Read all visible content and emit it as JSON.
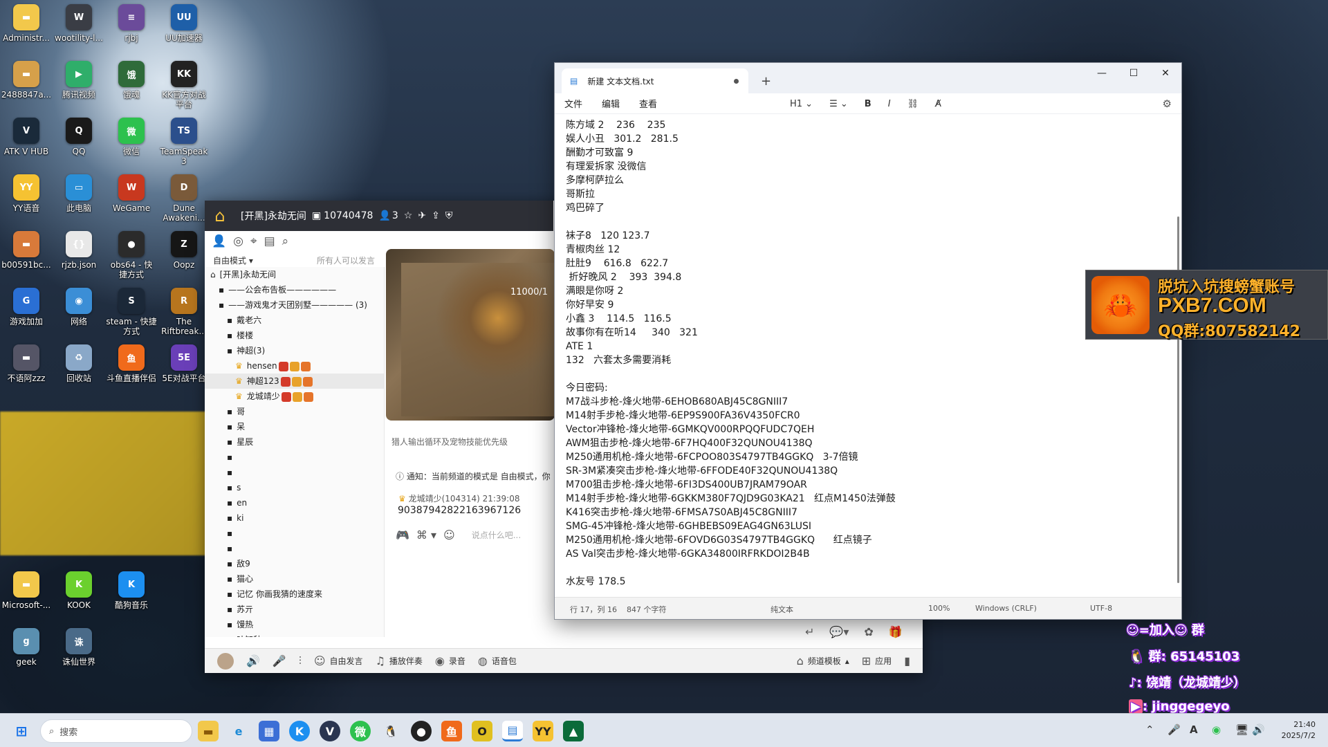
{
  "desktop_icons": [
    {
      "label": "Administr...",
      "glyph": "▬",
      "color": "#f2c84b"
    },
    {
      "label": "wootility-l...",
      "glyph": "W",
      "color": "#3a3d45"
    },
    {
      "label": "rjbj",
      "glyph": "≡",
      "color": "#6b4b9a"
    },
    {
      "label": "UU加速器",
      "glyph": "UU",
      "color": "#1e5fa8"
    },
    {
      "label": "2488847a...",
      "glyph": "▬",
      "color": "#d6a04a"
    },
    {
      "label": "腾讯视频",
      "glyph": "▶",
      "color": "#2fae6a"
    },
    {
      "label": "饿魂",
      "glyph": "饿",
      "color": "#2f6b3a"
    },
    {
      "label": "KK官方对战\n平台",
      "glyph": "KK",
      "color": "#222"
    },
    {
      "label": "ATK V HUB",
      "glyph": "V",
      "color": "#1a2a3a"
    },
    {
      "label": "QQ",
      "glyph": "Q",
      "color": "#1a1a1a"
    },
    {
      "label": "微信",
      "glyph": "微",
      "color": "#2dc14e"
    },
    {
      "label": "TeamSpeak\n3",
      "glyph": "TS",
      "color": "#2b4f8c"
    },
    {
      "label": "YY语音",
      "glyph": "YY",
      "color": "#f5c232"
    },
    {
      "label": "此电脑",
      "glyph": "▭",
      "color": "#2a8fd6"
    },
    {
      "label": "WeGame",
      "glyph": "W",
      "color": "#c8381f"
    },
    {
      "label": "Dune\nAwakeni...",
      "glyph": "D",
      "color": "#7a5a3a"
    },
    {
      "label": "b00591bc...",
      "glyph": "▬",
      "color": "#d87a3a"
    },
    {
      "label": "rjzb.json",
      "glyph": "{}",
      "color": "#e8e8e8"
    },
    {
      "label": "obs64 - 快\n捷方式",
      "glyph": "●",
      "color": "#2b2b2b"
    },
    {
      "label": "Oopz",
      "glyph": "Z",
      "color": "#161616"
    },
    {
      "label": "游戏加加",
      "glyph": "G",
      "color": "#2a6fd4"
    },
    {
      "label": "网络",
      "glyph": "◉",
      "color": "#3b8ed6"
    },
    {
      "label": "steam - 快捷\n方式",
      "glyph": "S",
      "color": "#1b2838"
    },
    {
      "label": "The\nRiftbreak...",
      "glyph": "R",
      "color": "#b7751e"
    },
    {
      "label": "不语阿zzz",
      "glyph": "▬",
      "color": "#556"
    },
    {
      "label": "回收站",
      "glyph": "♻",
      "color": "#8aa8c8"
    },
    {
      "label": "斗鱼直播伴侣",
      "glyph": "鱼",
      "color": "#f06a1b"
    },
    {
      "label": "5E对战平台",
      "glyph": "5E",
      "color": "#6a3fb8"
    },
    {
      "label": "Microsoft-...",
      "glyph": "▬",
      "color": "#f2c84b"
    },
    {
      "label": "KOOK",
      "glyph": "K",
      "color": "#6bd02e"
    },
    {
      "label": "酷狗音乐",
      "glyph": "K",
      "color": "#1c8ff0"
    },
    {
      "label": "geek",
      "glyph": "g",
      "color": "#5a8fb0"
    },
    {
      "label": "诛仙世界",
      "glyph": "诛",
      "color": "#4a6a88"
    }
  ],
  "chat_app": {
    "channel_name": "[开黑]永劫无间",
    "room_id": "10740478",
    "online_count": "3",
    "mode_label": "自由模式",
    "can_speak": "所有人可以发言",
    "tree": [
      {
        "text": "[开黑]永劫无间",
        "indent": 0
      },
      {
        "text": "——公会布告板——————",
        "indent": 1
      },
      {
        "text": "——游戏鬼才天团别墅————— (3)",
        "indent": 1
      },
      {
        "text": "戴老六",
        "indent": 2
      },
      {
        "text": "楼楼",
        "indent": 2
      },
      {
        "text": "神超(3)",
        "indent": 2
      },
      {
        "text": "hensen",
        "indent": 3
      },
      {
        "text": "神超123",
        "indent": 3
      },
      {
        "text": "龙城靖少",
        "indent": 3
      },
      {
        "text": "哥",
        "indent": 2
      },
      {
        "text": "呆",
        "indent": 2
      },
      {
        "text": "星辰",
        "indent": 2
      },
      {
        "text": "",
        "indent": 2
      },
      {
        "text": "",
        "indent": 2
      },
      {
        "text": "s",
        "indent": 2
      },
      {
        "text": "en",
        "indent": 2
      },
      {
        "text": "ki",
        "indent": 2
      },
      {
        "text": "",
        "indent": 2
      },
      {
        "text": "",
        "indent": 2
      },
      {
        "text": "敌9",
        "indent": 2
      },
      {
        "text": "猫心",
        "indent": 2
      },
      {
        "text": "记忆 你画我猜的速度来",
        "indent": 2
      },
      {
        "text": "苏亓",
        "indent": 2
      },
      {
        "text": "馒热",
        "indent": 2
      },
      {
        "text": "叶知秋",
        "indent": 2
      }
    ],
    "video_hp": "11000/1",
    "tip": "猎人输出循环及宠物技能优先级",
    "notice": "通知：当前频道的模式是 自由模式，你",
    "msg_sender": "龙城靖少(104314)  21:39:08",
    "msg_body": "903879428221639671​26",
    "input_placeholder": "说点什么吧...",
    "bottom": [
      "自由发言",
      "播放伴奏",
      "录音",
      "语音包",
      "频道模板",
      "应用"
    ]
  },
  "notepad": {
    "tab_title": "新建 文本文档.txt",
    "menu": [
      "文件",
      "编辑",
      "查看"
    ],
    "heading": "H1",
    "lines": [
      "陈方域 2    236    235",
      "娱人小丑   301.2   281.5",
      "酬勤才可致富 9",
      "有理爱拆家 没微信",
      "多摩柯萨拉么",
      "哥斯拉",
      "鸡巴碎了",
      "",
      "袜子8   120 123.7",
      "青椒肉丝 12",
      "肚肚9    616.8   622.7",
      " 折好晚风 2    393  394.8",
      "满眼是你呀 2",
      "你好早安 9",
      "小鑫 3    114.5   116.5",
      "故事你有在听14     340   321",
      "ATE 1",
      "132   六套太多需要消耗",
      "",
      "今日密码:",
      "M7战斗步枪-烽火地带-6EHOB680ABJ45C8GNIII7",
      "M14射手步枪-烽火地带-6EP9S900FA36V4350FCR0",
      "Vector冲锋枪-烽火地带-6GMKQV000RPQQFUDC7QEH",
      "AWM狙击步枪-烽火地带-6F7HQ400F32QUNOU4138Q",
      "M250通用机枪-烽火地带-6FCPOO803S4797TB4GGKQ   3-7倍镜",
      "SR-3M紧凑突击步枪-烽火地带-6FFODE40F32QUNOU4138Q",
      "M700狙击步枪-烽火地带-6FI3DS400UB7JRAM79OAR",
      "M14射手步枪-烽火地带-6GKKM380F7QJD9G03KA21   红点M1450法弹鼓",
      "K416突击步枪-烽火地带-6FMSA7S0ABJ45C8GNIII7",
      "SMG-45冲锋枪-烽火地带-6GHBEBS09EAG4GN63LUSI",
      "M250通用机枪-烽火地带-6FOVD6G03S4797TB4GGKQ      红点镜子",
      "AS Val突击步枪-烽火地带-6GKA34800IRFRKDOI2B4B",
      "",
      "水友号 178.5"
    ],
    "status": {
      "position": "行 17，列 16",
      "chars": "847 个字符",
      "mode": "纯文本",
      "zoom": "100%",
      "eol": "Windows (CRLF)",
      "encoding": "UTF-8"
    }
  },
  "ad": {
    "line1": "脱坑入坑搜螃蟹账号",
    "line2": "PXB7.COM",
    "line3": "QQ群:807582142"
  },
  "overlay": {
    "join": "☺=加入☺ 群",
    "group": "群: 65145103",
    "douyin": ": 饶靖（龙城靖少）",
    "bili": ": jinggegeyo"
  },
  "taskbar": {
    "search_placeholder": "搜索",
    "time": "21:40",
    "date": "2025/7/2",
    "ime": "A"
  }
}
